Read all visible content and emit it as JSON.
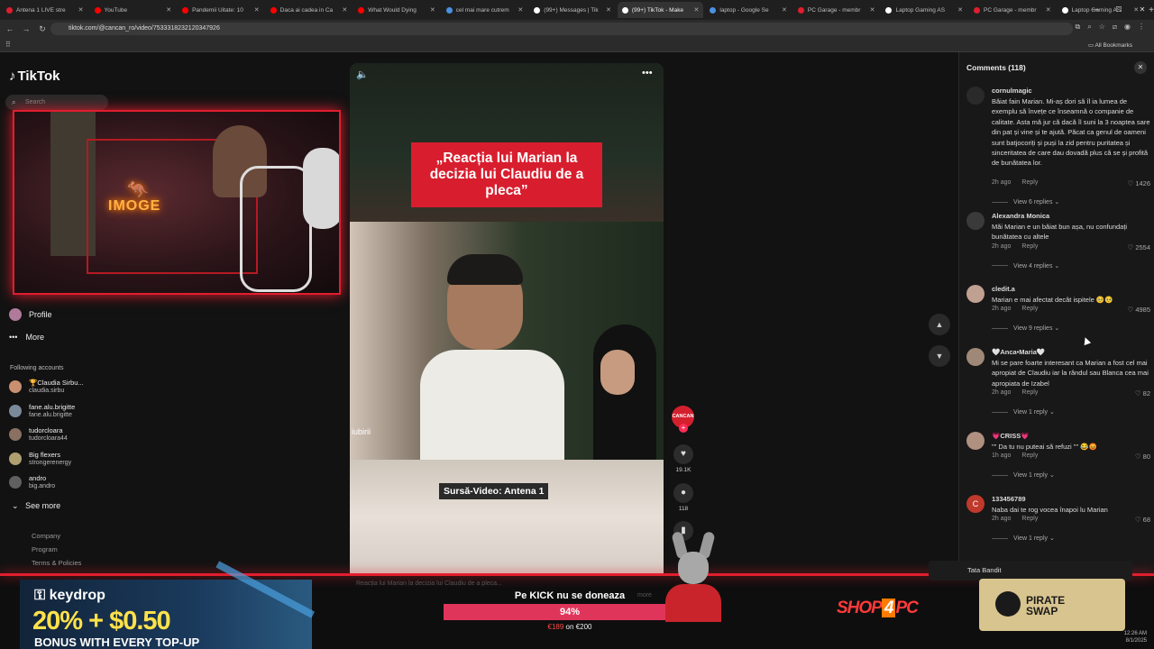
{
  "browser": {
    "tabs": [
      {
        "title": "Antena 1 LIVE stre",
        "color": "#e01e2e",
        "active": false
      },
      {
        "title": "YouTube",
        "color": "#ff0000",
        "active": false
      },
      {
        "title": "Pandemii Uitate: 10",
        "color": "#ff0000",
        "active": false
      },
      {
        "title": "Daca ai cadea in Ca",
        "color": "#ff0000",
        "active": false
      },
      {
        "title": "What Would Dying",
        "color": "#ff0000",
        "active": false
      },
      {
        "title": "cel mai mare cutrem",
        "color": "#4a90e2",
        "active": false
      },
      {
        "title": "(99+) Messages | Tik",
        "color": "#ffffff",
        "active": false
      },
      {
        "title": "(99+) TikTok - Make",
        "color": "#ffffff",
        "active": true
      },
      {
        "title": "laptop - Google Se",
        "color": "#4a90e2",
        "active": false
      },
      {
        "title": "PC Garage - membr",
        "color": "#e01e2e",
        "active": false
      },
      {
        "title": "Laptop Gaming AS",
        "color": "#ffffff",
        "active": false
      },
      {
        "title": "PC Garage - membr",
        "color": "#e01e2e",
        "active": false
      },
      {
        "title": "Laptop Gaming AS",
        "color": "#ffffff",
        "active": false
      }
    ],
    "new_tab": "+",
    "url": "tiktok.com/@cancan_ro/video/7533318232120347926",
    "all_bookmarks": "All Bookmarks"
  },
  "tiktok": {
    "logo": "TikTok",
    "search_placeholder": "Search",
    "nav": {
      "profile": "Profile",
      "more": "More"
    },
    "following_title": "Following accounts",
    "accounts": [
      {
        "name": "🏆Claudia Sirbu...",
        "handle": "claudia.sirbu",
        "color": "#c89070"
      },
      {
        "name": "fane.alu.brigitte",
        "handle": "fane.alu.brigitte",
        "color": "#7a8a9a"
      },
      {
        "name": "tudorcloara",
        "handle": "tudorcloara44",
        "color": "#8a7060"
      },
      {
        "name": "Big flexers",
        "handle": "strongerenergy",
        "color": "#b0a070"
      },
      {
        "name": "andro",
        "handle": "big.andro",
        "color": "#606060"
      }
    ],
    "see_more": "See more",
    "footer": [
      "Company",
      "Program",
      "Terms & Policies"
    ]
  },
  "video": {
    "headline": "„Reacția lui Marian la decizia lui Claudiu de a pleca”",
    "source": "Sursă-Video: Antena 1",
    "watermark": "iubirii",
    "creator_badge": "CANCAN",
    "likes": "19.1K",
    "comments": "118",
    "caption": "Reacția lui Marian la decizia lui Claudiu de a pleca...",
    "more": "more"
  },
  "comments_panel": {
    "title": "Comments (118)",
    "items": [
      {
        "user": "cornulmagic",
        "text": "Băiat fain Marian. Mi-aș dori să îl ia lumea de exemplu să învețe ce înseamnă o companie de calitate. Asta mă jur că dacă îl suni la 3 noaptea sare din pat și vine și te ajută. Păcat ca genul de oameni sunt batjocoriți și puși la zid pentru puritatea și sinceritatea de care dau dovadă plus că se și profită de bunătatea lor.",
        "time": "2h ago",
        "reply": "Reply",
        "likes": "1426",
        "view": "View 6 replies",
        "avatar": "#2a2a2a"
      },
      {
        "user": "Alexandra Monica",
        "text": "Măi Marian e un băiat bun așa, nu confundați bunătatea cu altele",
        "time": "2h ago",
        "reply": "Reply",
        "likes": "2554",
        "view": "View 4 replies",
        "avatar": "#3a3a3a"
      },
      {
        "user": "cledit.a",
        "text": "Marian e mai afectat decât ispitele 🥺🥺",
        "time": "2h ago",
        "reply": "Reply",
        "likes": "4985",
        "view": "View 9 replies",
        "avatar": "#c0a090"
      },
      {
        "user": "🤍Anca•Maria🤍",
        "text": "Mi se pare foarte interesant ca Marian a fost cel mai apropiat de Claudiu iar la rândul sau Blanca cea mai apropiata de Izabel",
        "time": "2h ago",
        "reply": "Reply",
        "likes": "82",
        "view": "View 1 reply",
        "avatar": "#a08878"
      },
      {
        "user": "💗CRISS💗",
        "text": "\"\" Da tu nu puteai să refuzi \"\" 😂😡",
        "time": "1h ago",
        "reply": "Reply",
        "likes": "80",
        "view": "View 1 reply",
        "avatar": "#b09080"
      },
      {
        "user": "133456789",
        "text": "Naba dai te rog vocea înapoi lu Marian",
        "time": "2h ago",
        "reply": "Reply",
        "likes": "68",
        "view": "View 1 reply",
        "avatar": "#c0392b",
        "initial": "C"
      }
    ]
  },
  "stream_overlay": {
    "cam_text": "IMOGE",
    "keydrop_logo": "keydrop",
    "keydrop_promo": "20% + $0.50",
    "keydrop_sub": "BONUS WITH EVERY TOP-UP",
    "donate_label": "Pe KICK nu se doneaza",
    "donate_percent": "94%",
    "donate_progress": 0.94,
    "donate_current": "€189",
    "donate_goal": "€200",
    "donate_of": "on",
    "shop_a": "SHOP",
    "shop_b": "4",
    "shop_c": "PC",
    "pirate_a": "PIRATE",
    "pirate_b": "SWAP",
    "chat_name": "Tata Bandit",
    "clock": "12:26 AM",
    "date": "8/1/2025"
  }
}
